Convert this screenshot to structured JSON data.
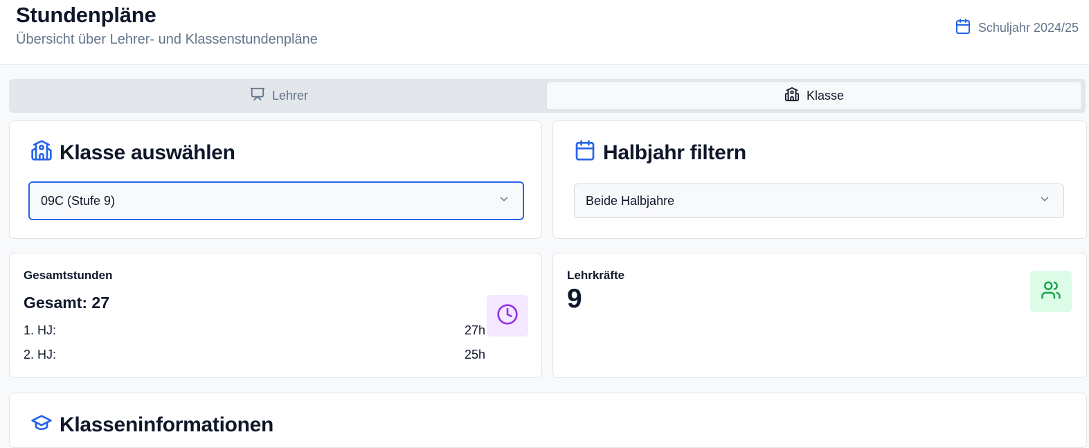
{
  "header": {
    "title": "Stundenpläne",
    "subtitle": "Übersicht über Lehrer- und Klassenstundenpläne",
    "school_year": "Schuljahr 2024/25"
  },
  "tabs": [
    {
      "label": "Lehrer",
      "icon": "presentation-icon",
      "active": false
    },
    {
      "label": "Klasse",
      "icon": "school-icon",
      "active": true
    }
  ],
  "class_select": {
    "title": "Klasse auswählen",
    "value": "09C (Stufe 9)"
  },
  "semester_filter": {
    "title": "Halbjahr filtern",
    "value": "Beide Halbjahre"
  },
  "total_hours": {
    "label": "Gesamtstunden",
    "total": "Gesamt: 27",
    "rows": [
      {
        "label": "1. HJ:",
        "value": "27h"
      },
      {
        "label": "2. HJ:",
        "value": "25h"
      }
    ]
  },
  "teachers": {
    "label": "Lehrkräfte",
    "count": "9"
  },
  "class_info": {
    "title": "Klasseninformationen"
  },
  "colors": {
    "accent_blue": "#2563eb",
    "purple_icon": "#9333ea",
    "purple_bg": "#f3e8ff",
    "green_icon": "#16a34a",
    "green_bg": "#dcfce7"
  }
}
